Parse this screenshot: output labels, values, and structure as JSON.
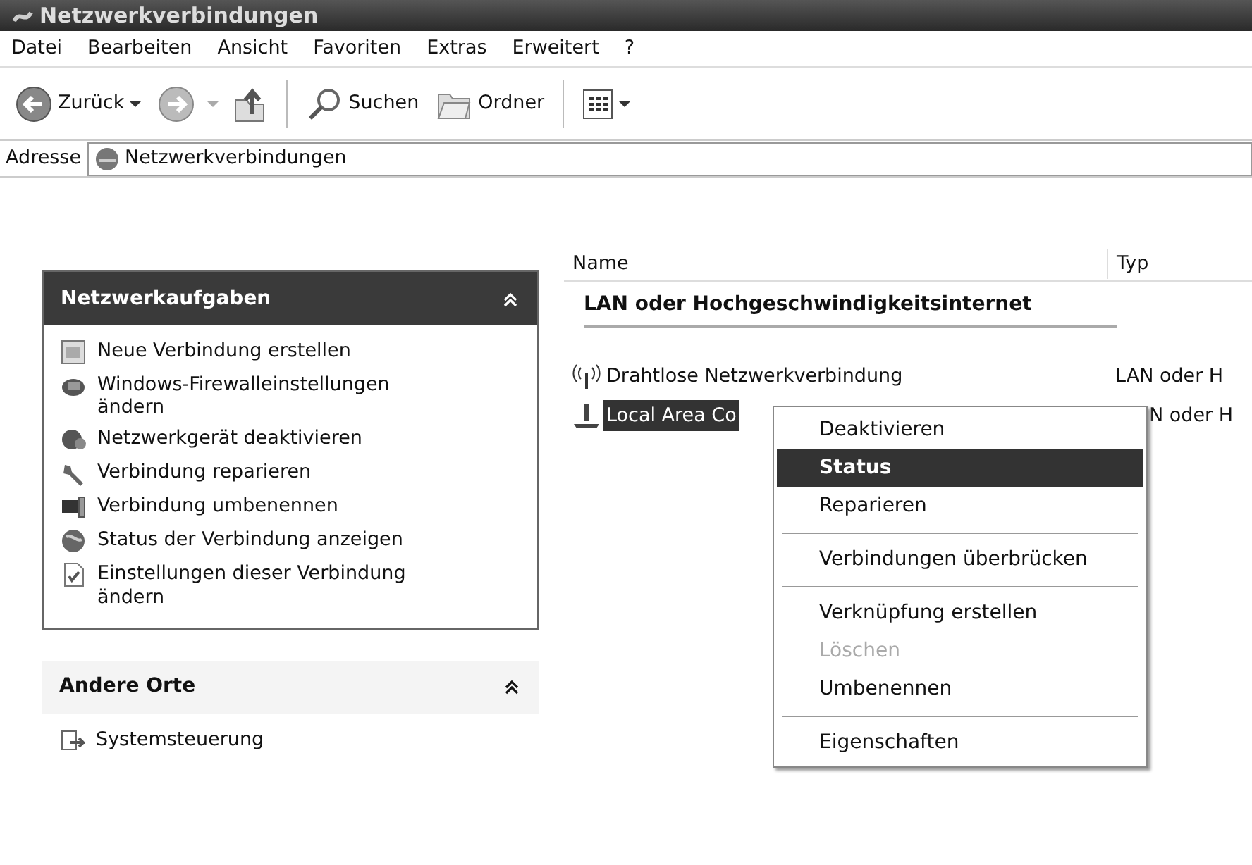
{
  "window": {
    "title": "Netzwerkverbindungen"
  },
  "menu_bar": [
    "Datei",
    "Bearbeiten",
    "Ansicht",
    "Favoriten",
    "Extras",
    "Erweitert",
    "?"
  ],
  "toolbar": [
    {
      "kind": "back",
      "label": "Zurück"
    },
    {
      "kind": "forward"
    },
    {
      "kind": "up"
    },
    {
      "kind": "search",
      "label": "Suchen"
    },
    {
      "kind": "folders",
      "label": "Ordner"
    },
    {
      "kind": "views"
    }
  ],
  "address_bar": {
    "label": "Adresse",
    "value": "Netzwerkverbindungen"
  },
  "task_panels": [
    {
      "kind": "primary",
      "title": "Netzwerkaufgaben",
      "items": [
        {
          "kind": "new",
          "label": "Neue Verbindung erstellen"
        },
        {
          "kind": "firewall",
          "label": "Windows-Firewalleinstellungen ändern"
        },
        {
          "kind": "disable",
          "label": "Netzwerkgerät deaktivieren"
        },
        {
          "kind": "repair",
          "label": "Verbindung reparieren"
        },
        {
          "kind": "rename",
          "label": "Verbindung umbenennen"
        },
        {
          "kind": "status",
          "label": "Status der Verbindung anzeigen"
        },
        {
          "kind": "settings",
          "label": "Einstellungen dieser Verbindung ändern"
        }
      ]
    },
    {
      "kind": "secondary",
      "title": "Andere Orte",
      "items": [
        {
          "kind": "control",
          "label": "Systemsteuerung"
        }
      ]
    }
  ],
  "file_list": {
    "columns": [
      "Name",
      "Typ"
    ],
    "groups": [
      {
        "title": "LAN oder Hochgeschwindigkeitsinternet",
        "rows": [
          {
            "kind": "wireless",
            "name": "Drahtlose Netzwerkverbindung",
            "type": "LAN oder H",
            "selected": false
          },
          {
            "kind": "lan",
            "name": "Local Area Co",
            "type": "N oder H",
            "selected": true
          }
        ]
      }
    ]
  },
  "context_menu": {
    "items": [
      {
        "kind": "item",
        "label": "Deaktivieren",
        "selected": false,
        "default": false,
        "disabled": false
      },
      {
        "kind": "item",
        "label": "Status",
        "selected": true,
        "default": true,
        "disabled": false
      },
      {
        "kind": "item",
        "label": "Reparieren",
        "selected": false,
        "default": false,
        "disabled": false
      },
      {
        "kind": "separator"
      },
      {
        "kind": "item",
        "label": "Verbindungen überbrücken",
        "selected": false,
        "default": false,
        "disabled": false
      },
      {
        "kind": "separator"
      },
      {
        "kind": "item",
        "label": "Verknüpfung erstellen",
        "selected": false,
        "default": false,
        "disabled": false
      },
      {
        "kind": "item",
        "label": "Löschen",
        "selected": false,
        "default": false,
        "disabled": true
      },
      {
        "kind": "item",
        "label": "Umbenennen",
        "selected": false,
        "default": false,
        "disabled": false
      },
      {
        "kind": "separator"
      },
      {
        "kind": "item",
        "label": "Eigenschaften",
        "selected": false,
        "default": false,
        "disabled": false
      }
    ]
  }
}
